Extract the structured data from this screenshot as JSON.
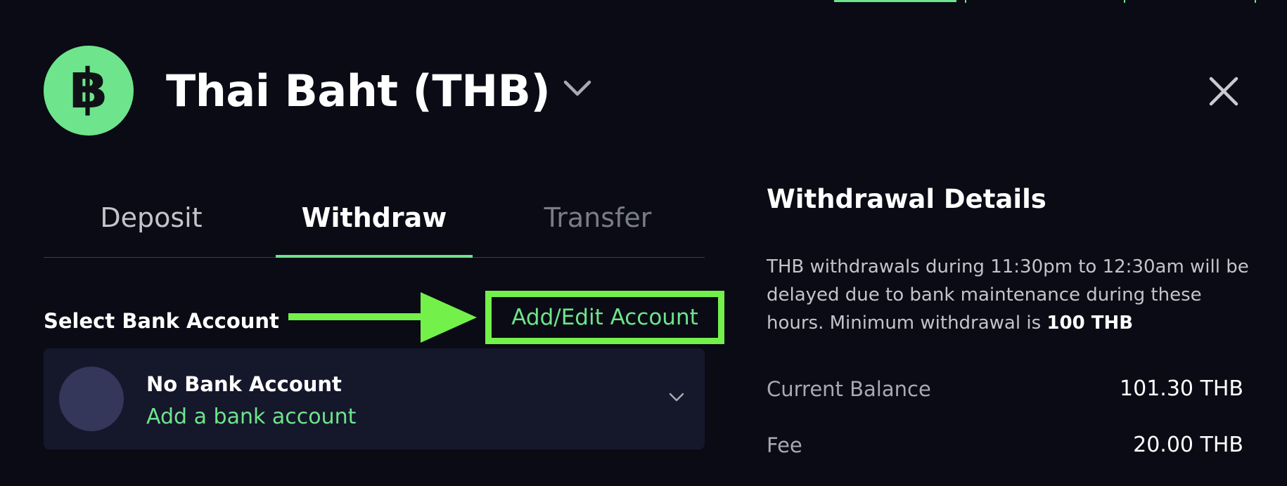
{
  "header": {
    "currency_symbol": "฿",
    "title": "Thai Baht (THB)"
  },
  "tabs": [
    {
      "label": "Deposit",
      "state": "inactive"
    },
    {
      "label": "Withdraw",
      "state": "active"
    },
    {
      "label": "Transfer",
      "state": "disabled"
    }
  ],
  "bank_section": {
    "label": "Select Bank Account",
    "add_edit_link": "Add/Edit Account",
    "selected_account": {
      "name": "No Bank Account",
      "action": "Add a bank account"
    }
  },
  "details": {
    "title": "Withdrawal Details",
    "description": "THB withdrawals during 11:30pm to 12:30am will be delayed due to bank maintenance during these hours. Minimum withdrawal is ",
    "min_withdrawal": "100 THB",
    "rows": [
      {
        "label": "Current Balance",
        "value": "101.30 THB"
      },
      {
        "label": "Fee",
        "value": "20.00 THB"
      }
    ]
  },
  "colors": {
    "accent": "#6ee48c",
    "highlight": "#73f04a",
    "background": "#0a0b14",
    "card": "#15172b"
  },
  "icons": [
    "baht-coin-icon",
    "chevron-down-icon",
    "close-icon",
    "arrow-right-icon"
  ]
}
